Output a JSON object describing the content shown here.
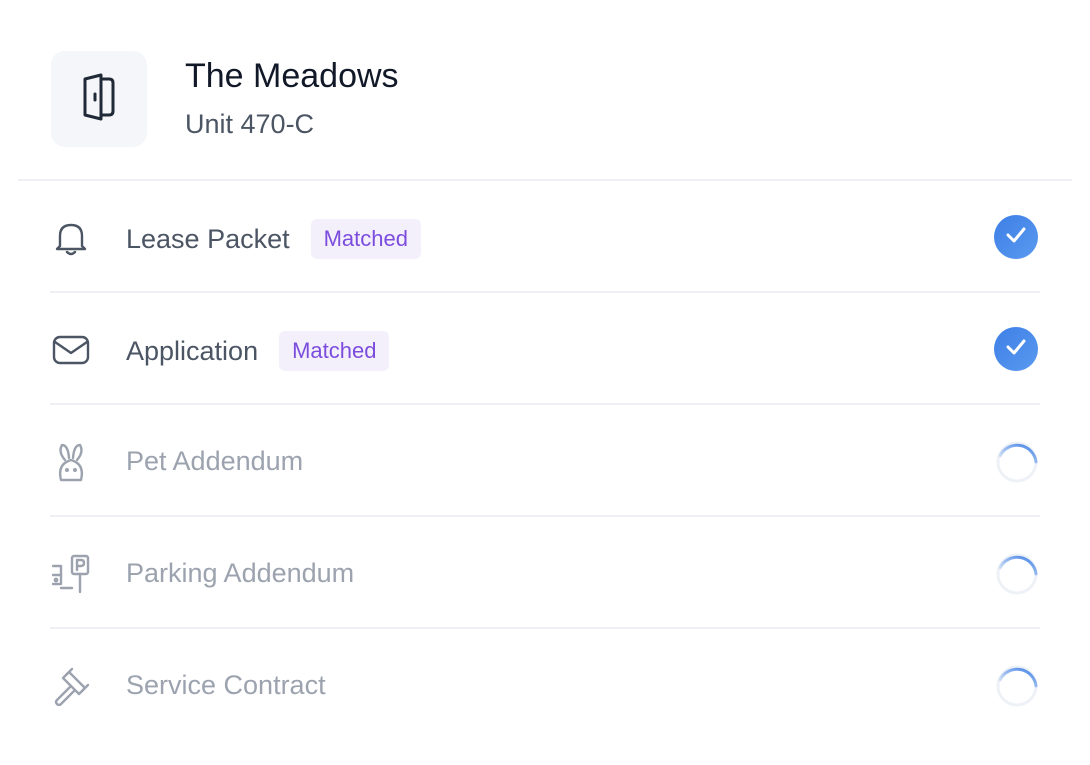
{
  "property": {
    "name": "The Meadows",
    "unit": "Unit 470-C",
    "icon": "door-icon"
  },
  "documents": [
    {
      "label": "Lease Packet",
      "icon": "bell-icon",
      "badge": "Matched",
      "status": "complete"
    },
    {
      "label": "Application",
      "icon": "mail-icon",
      "badge": "Matched",
      "status": "complete"
    },
    {
      "label": "Pet Addendum",
      "icon": "rabbit-icon",
      "badge": "",
      "status": "loading"
    },
    {
      "label": "Parking Addendum",
      "icon": "parking-icon",
      "badge": "",
      "status": "loading"
    },
    {
      "label": "Service Contract",
      "icon": "gavel-icon",
      "badge": "",
      "status": "loading"
    }
  ],
  "colors": {
    "accent": "#3d7fe6",
    "badge_text": "#7c4ddd",
    "badge_bg": "#f3f0fc"
  }
}
